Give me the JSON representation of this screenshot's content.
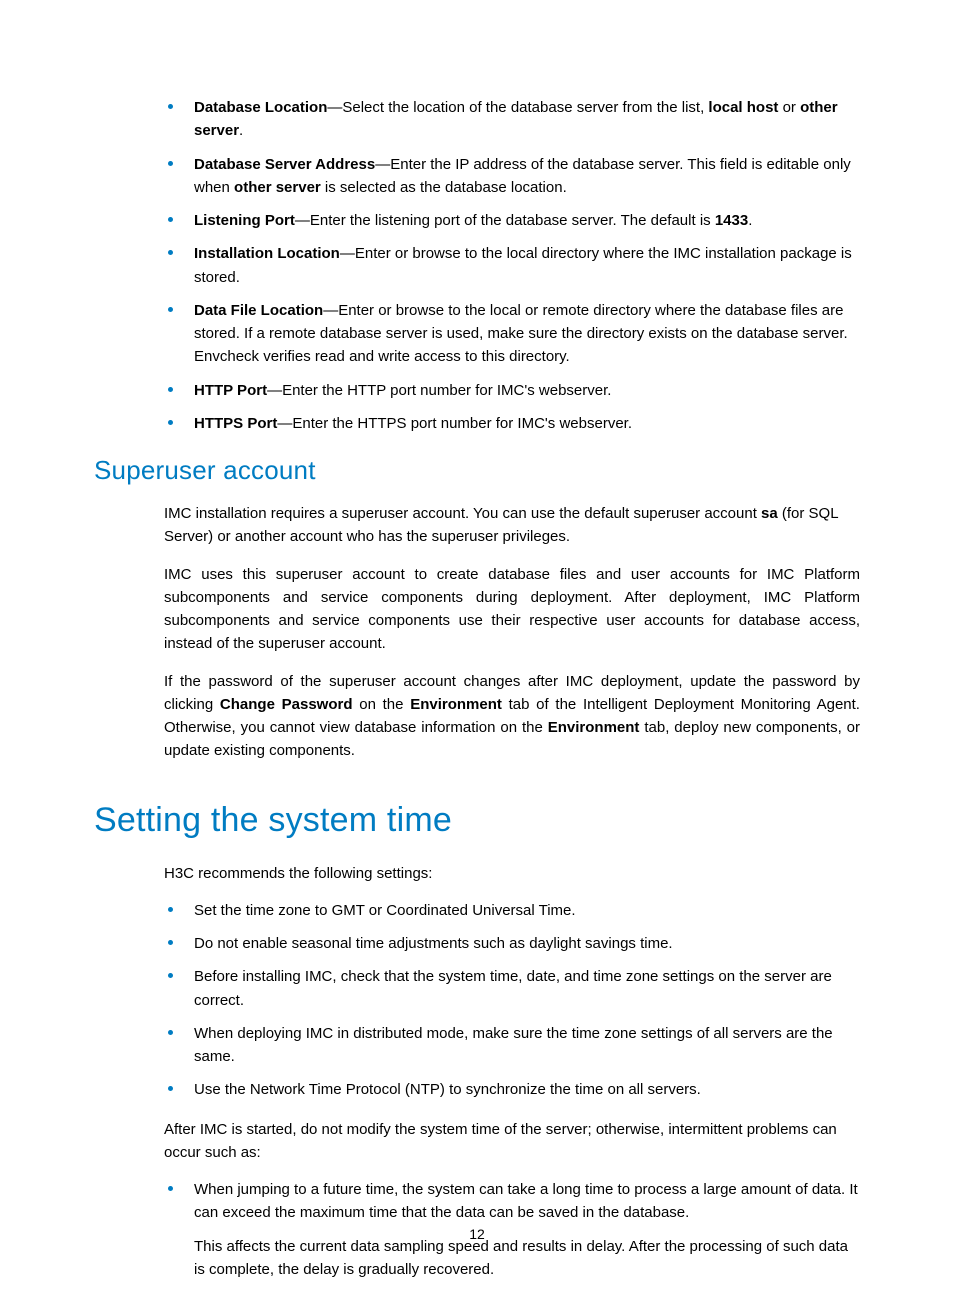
{
  "bullets1": [
    {
      "term": "Database Location",
      "pre": "—Select the location of the database server from the list, ",
      "bold1": "local host",
      "mid": " or ",
      "bold2": "other server",
      "post": "."
    },
    {
      "term": "Database Server Address",
      "pre": "—Enter the IP address of the database server. This field is editable only when ",
      "bold1": "other server",
      "mid": " is selected as the database location.",
      "bold2": "",
      "post": ""
    },
    {
      "term": "Listening Port",
      "pre": "—Enter the listening port of the database server. The default is ",
      "bold1": "1433",
      "mid": ".",
      "bold2": "",
      "post": ""
    },
    {
      "term": "Installation Location",
      "pre": "—Enter or browse to the local directory where the IMC installation package is stored.",
      "bold1": "",
      "mid": "",
      "bold2": "",
      "post": ""
    },
    {
      "term": "Data File Location",
      "pre": "—Enter or browse to the local or remote directory where the database files are stored. If a remote database server is used, make sure the directory exists on the database server. Envcheck verifies read and write access to this directory.",
      "bold1": "",
      "mid": "",
      "bold2": "",
      "post": ""
    },
    {
      "term": "HTTP Port",
      "pre": "—Enter the HTTP port number for IMC's webserver.",
      "bold1": "",
      "mid": "",
      "bold2": "",
      "post": ""
    },
    {
      "term": "HTTPS Port",
      "pre": "—Enter the HTTPS port number for IMC's webserver.",
      "bold1": "",
      "mid": "",
      "bold2": "",
      "post": ""
    }
  ],
  "h2a": "Superuser account",
  "p1": {
    "pre": "IMC installation requires a superuser account. You can use the default superuser account ",
    "bold": "sa",
    "post": " (for SQL Server) or another account who has the superuser privileges."
  },
  "p2": "IMC uses this superuser account to create database files and user accounts for IMC Platform subcomponents and service components during deployment. After deployment, IMC Platform subcomponents and service components use their respective user accounts for database access, instead of the superuser account.",
  "p3": {
    "pre": "If the password of the superuser account changes after IMC deployment, update the password by clicking ",
    "b1": "Change Password",
    "mid1": " on the ",
    "b2": "Environment",
    "mid2": " tab of the Intelligent Deployment Monitoring Agent. Otherwise, you cannot view database information on the ",
    "b3": "Environment",
    "post": " tab, deploy new components, or update existing components."
  },
  "h1a": "Setting the system time",
  "p4": "H3C recommends the following settings:",
  "bullets2": [
    "Set the time zone to GMT or Coordinated Universal Time.",
    "Do not enable seasonal time adjustments such as daylight savings time.",
    "Before installing IMC, check that the system time, date, and time zone settings on the server are correct.",
    "When deploying IMC in distributed mode, make sure the time zone settings of all servers are the same.",
    "Use the Network Time Protocol (NTP) to synchronize the time on all servers."
  ],
  "p5": "After IMC is started, do not modify the system time of the server; otherwise, intermittent problems can occur such as:",
  "bullets3": [
    {
      "main": "When jumping to a future time, the system can take a long time to process a large amount of data. It can exceed the maximum time that the data can be saved in the database.",
      "sub": "This affects the current data sampling speed and results in delay. After the processing of such data is complete, the delay is gradually recovered."
    }
  ],
  "pageNum": "12"
}
